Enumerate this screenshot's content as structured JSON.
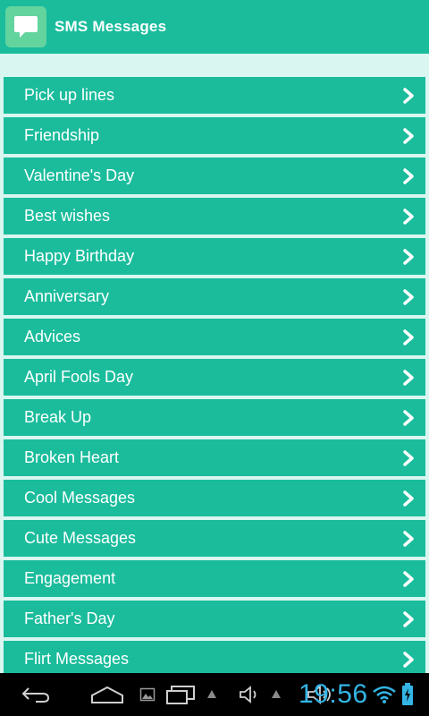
{
  "app_bar": {
    "title": "SMS Messages",
    "icon": "speech-bubble-icon",
    "colors": {
      "bar": "#1abc9c",
      "icon_bg": "#63d49e"
    }
  },
  "list": {
    "item_color": "#1abc9c",
    "items": [
      {
        "label": "Pick up lines"
      },
      {
        "label": "Friendship"
      },
      {
        "label": "Valentine's Day"
      },
      {
        "label": "Best wishes"
      },
      {
        "label": "Happy Birthday"
      },
      {
        "label": "Anniversary"
      },
      {
        "label": "Advices"
      },
      {
        "label": "April Fools Day"
      },
      {
        "label": "Break Up"
      },
      {
        "label": "Broken Heart"
      },
      {
        "label": "Cool Messages"
      },
      {
        "label": "Cute Messages"
      },
      {
        "label": "Engagement"
      },
      {
        "label": "Father's Day"
      },
      {
        "label": "Flirt Messages"
      }
    ]
  },
  "system_bar": {
    "clock": "19:56",
    "clock_color": "#33b5e5",
    "icons": [
      "back-icon",
      "home-icon",
      "screenshot-icon",
      "recent-apps-icon",
      "volume-down-icon",
      "volume-up-icon",
      "wifi-icon",
      "battery-icon"
    ]
  }
}
